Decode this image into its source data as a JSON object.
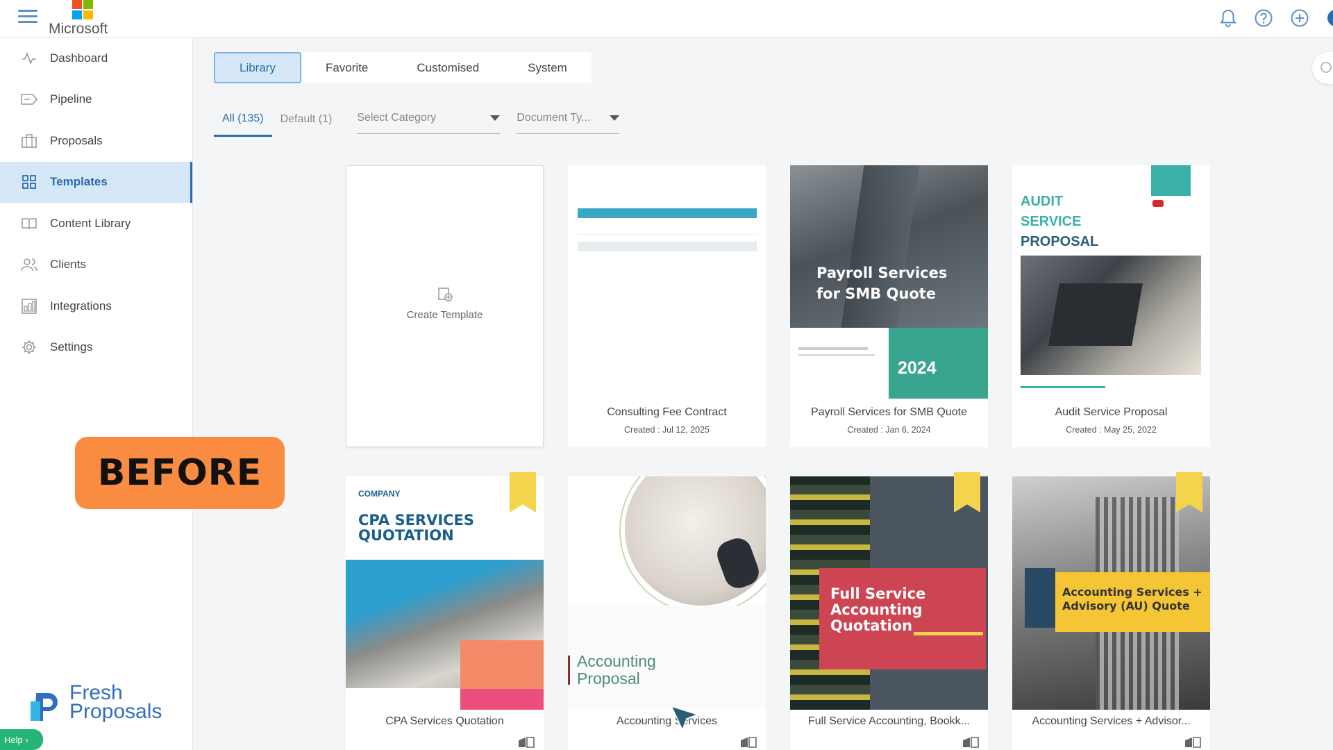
{
  "app": {
    "brand": "Microsoft"
  },
  "colors": {
    "accent": "#2a6cb0",
    "activeBg": "#d6e8f8",
    "badge": "#f98c40",
    "help": "#27b577"
  },
  "topbar": {
    "icons": [
      "bell-icon",
      "help-circle-icon",
      "plus-circle-icon"
    ]
  },
  "sidebar": {
    "items": [
      {
        "label": "Dashboard",
        "icon": "activity-icon",
        "active": false
      },
      {
        "label": "Pipeline",
        "icon": "tag-icon",
        "active": false
      },
      {
        "label": "Proposals",
        "icon": "briefcase-icon",
        "active": false
      },
      {
        "label": "Templates",
        "icon": "grid-icon",
        "active": true
      },
      {
        "label": "Content Library",
        "icon": "book-icon",
        "active": false
      },
      {
        "label": "Clients",
        "icon": "users-icon",
        "active": false
      },
      {
        "label": "Integrations",
        "icon": "integrations-icon",
        "active": false
      },
      {
        "label": "Settings",
        "icon": "gear-icon",
        "active": false
      }
    ],
    "badge": "BEFORE",
    "brand": {
      "line1": "Fresh",
      "line2": "Proposals"
    },
    "help": "Help"
  },
  "tabs": [
    {
      "label": "Library",
      "active": true
    },
    {
      "label": "Favorite",
      "active": false
    },
    {
      "label": "Customised",
      "active": false
    },
    {
      "label": "System",
      "active": false
    }
  ],
  "filters": {
    "all": "All (135)",
    "default": "Default (1)",
    "category_placeholder": "Select Category",
    "doctype_placeholder": "Document Ty..."
  },
  "cards": [
    {
      "title": "Create Template"
    },
    {
      "title": "Consulting Fee Contract",
      "date": "Created : Jul 12, 2025"
    },
    {
      "title": "Payroll Services for SMB Quote",
      "date": "Created : Jan 6, 2024",
      "thumb": {
        "heading": "Payroll Services for SMB Quote",
        "year": "2024"
      }
    },
    {
      "title": "Audit Service Proposal",
      "date": "Created : May 25, 2022",
      "thumb": {
        "heading_l1": "AUDIT",
        "heading_l2": "SERVICE",
        "heading_l3": "PROPOSAL"
      }
    },
    {
      "title": "CPA Services Quotation",
      "thumb": {
        "company": "COMPANY",
        "heading_l1": "CPA SERVICES",
        "heading_l2": "QUOTATION"
      }
    },
    {
      "title": "Accounting Services",
      "thumb": {
        "heading_l1": "Accounting",
        "heading_l2": "Proposal"
      }
    },
    {
      "title": "Full Service Accounting, Bookk...",
      "thumb": {
        "heading_l1": "Full Service",
        "heading_l2": "Accounting",
        "heading_l3": "Quotation"
      }
    },
    {
      "title": "Accounting Services + Advisor...",
      "thumb": {
        "heading_l1": "Accounting Services +",
        "heading_l2": "Advisory (AU) Quote"
      }
    }
  ]
}
